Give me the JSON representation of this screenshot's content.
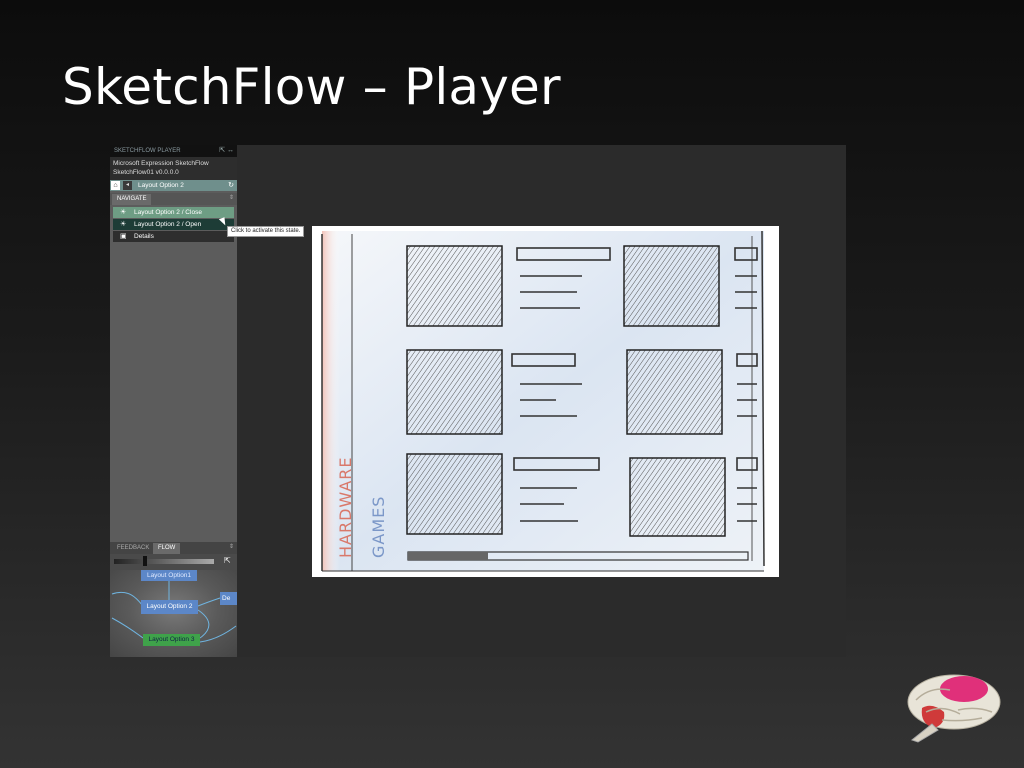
{
  "slide": {
    "title": "SketchFlow – Player"
  },
  "player": {
    "header_title": "SKETCHFLOW PLAYER",
    "header_icons": "⇱ ↔",
    "app_name": "Microsoft Expression SketchFlow",
    "project_version": "SketchFlow01 v0.0.0.0",
    "nav_bar": {
      "home_icon": "home-icon",
      "back_icon": "back-icon",
      "current_screen": "Layout Option 2",
      "refresh_icon": "refresh-icon",
      "home_glyph": "⌂",
      "back_glyph": "◂",
      "refresh_glyph": "↻"
    },
    "navigate_tab": {
      "label": "NAVIGATE",
      "pin": "⇕"
    },
    "nav_items": [
      {
        "icon": "lightbulb-icon",
        "glyph": "☀",
        "label": "Layout Option 2 / Close"
      },
      {
        "icon": "lightbulb-icon",
        "glyph": "☀",
        "label": "Layout Option 2 / Open"
      },
      {
        "icon": "screen-icon",
        "glyph": "▣",
        "label": "Details"
      }
    ],
    "tooltip": "Click to activate this state.",
    "lower_tabs": {
      "feedback": "FEEDBACK",
      "flow": "FLOW",
      "pin": "⇕",
      "export_glyph": "⇱"
    },
    "flow_zoom": 0.3,
    "flow_nodes": [
      {
        "label": "Layout Option1"
      },
      {
        "label": "Layout Option 2"
      },
      {
        "label": "De"
      },
      {
        "label": "Layout Option 3"
      }
    ]
  },
  "sketch": {
    "labels": [
      "HARDWARE",
      "GAMES"
    ]
  },
  "colors": {
    "flow_node_blue": "#5c87c8",
    "flow_node_green": "#3fa24a",
    "nav_highlight": "#6e9d84",
    "nav_selected": "#1d3c36"
  },
  "logo": "brain-logo"
}
